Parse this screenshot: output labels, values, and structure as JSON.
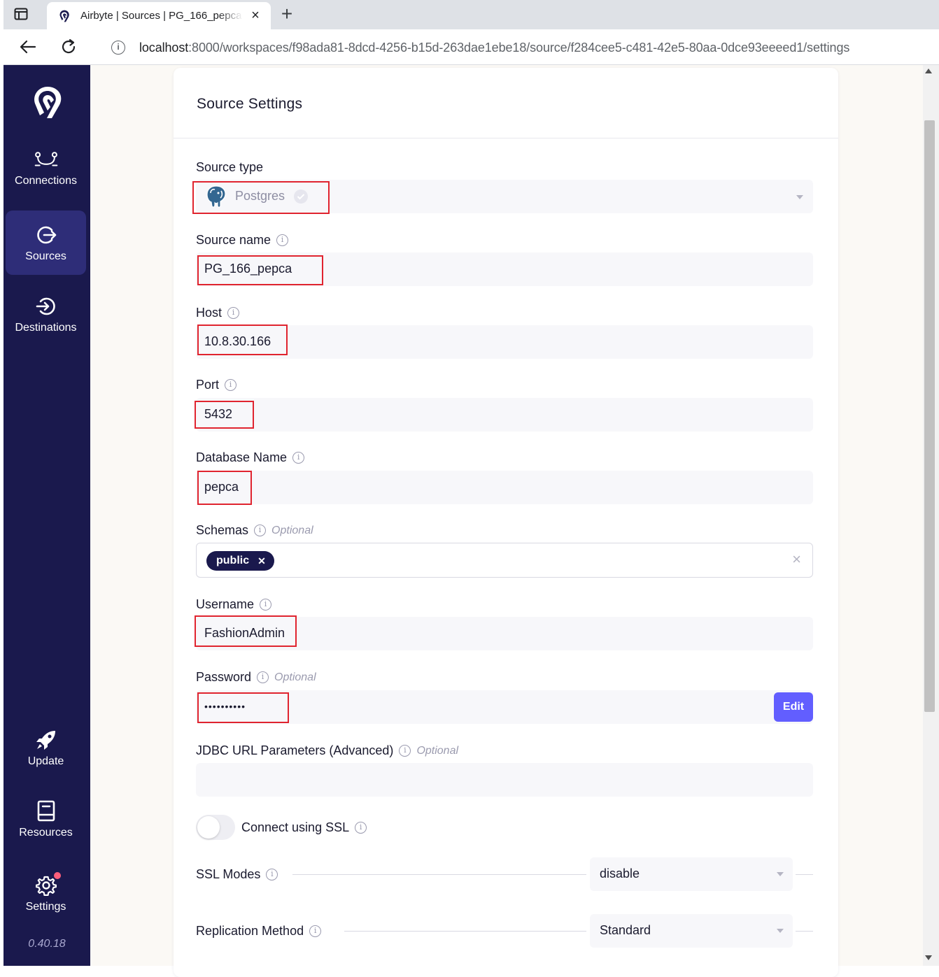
{
  "browser": {
    "tab_title": "Airbyte | Sources | PG_166_pepca",
    "url_host": "localhost",
    "url_rest": ":8000/workspaces/f98ada81-8dcd-4256-b15d-263dae1ebe18/source/f284cee5-c481-42e5-80aa-0dce93eeeed1/settings"
  },
  "sidebar": {
    "items": [
      {
        "label": "Connections",
        "icon": "connections-icon"
      },
      {
        "label": "Sources",
        "icon": "sources-icon",
        "active": true
      },
      {
        "label": "Destinations",
        "icon": "destinations-icon"
      },
      {
        "label": "Update",
        "icon": "rocket-icon"
      },
      {
        "label": "Resources",
        "icon": "book-icon"
      },
      {
        "label": "Settings",
        "icon": "gear-icon"
      }
    ],
    "version": "0.40.18"
  },
  "card": {
    "title": "Source Settings"
  },
  "form": {
    "source_type": {
      "label": "Source type",
      "value": "Postgres"
    },
    "source_name": {
      "label": "Source name",
      "value": "PG_166_pepca"
    },
    "host": {
      "label": "Host",
      "value": "10.8.30.166"
    },
    "port": {
      "label": "Port",
      "value": "5432"
    },
    "database_name": {
      "label": "Database Name",
      "value": "pepca"
    },
    "schemas": {
      "label": "Schemas",
      "optional": "Optional",
      "chips": [
        "public"
      ]
    },
    "username": {
      "label": "Username",
      "value": "FashionAdmin"
    },
    "password": {
      "label": "Password",
      "optional": "Optional",
      "value": "••••••••••",
      "edit_label": "Edit"
    },
    "jdbc": {
      "label": "JDBC URL Parameters (Advanced)",
      "optional": "Optional",
      "value": ""
    },
    "ssl": {
      "label": "Connect using SSL",
      "enabled": false
    },
    "ssl_modes": {
      "label": "SSL Modes",
      "value": "disable"
    },
    "replication": {
      "label": "Replication Method",
      "value": "Standard"
    }
  },
  "colors": {
    "sidebar_bg": "#1a194d",
    "accent": "#625eff",
    "highlight": "#e0242f"
  }
}
